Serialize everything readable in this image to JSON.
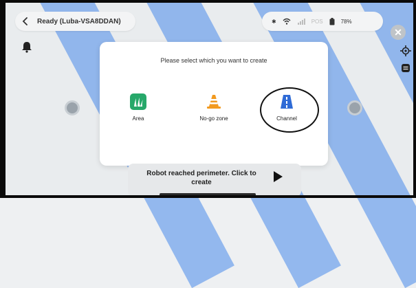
{
  "status": {
    "title": "Ready (Luba-VSA8DDAN)",
    "signal_label": "POS",
    "battery": "78%"
  },
  "dialog": {
    "prompt": "Please select which you want to create",
    "options": [
      {
        "label": "Area",
        "icon": "grass-icon"
      },
      {
        "label": "No-go zone",
        "icon": "traffic-cone-icon"
      },
      {
        "label": "Channel",
        "icon": "road-icon"
      }
    ]
  },
  "banner": {
    "message": "Robot reached perimeter. Click to create"
  },
  "colors": {
    "area_green": "#27a86a",
    "cone_orange": "#f29a1f",
    "channel_blue": "#2f6bd6"
  }
}
